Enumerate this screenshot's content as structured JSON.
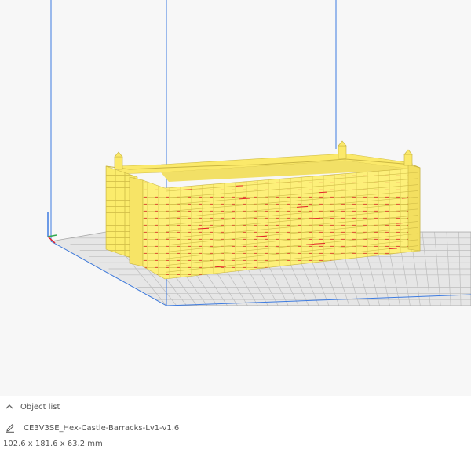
{
  "object_panel": {
    "header_label": "Object list",
    "file_name": "CE3V3SE_Hex-Castle-Barracks-Lv1-v1.6",
    "dimensions": "102.6 x 181.6 x 63.2 mm"
  },
  "icons": {
    "collapse": "chevron-up-icon",
    "edit": "pencil-icon"
  },
  "colors": {
    "model": "#fdf07a",
    "model_edge": "#d9c94a",
    "overhang": "#e5222a",
    "bed": "#e6e6e6",
    "grid": "#b8b8b8",
    "build_volume": "#3d7be0",
    "background": "#f7f7f7"
  }
}
